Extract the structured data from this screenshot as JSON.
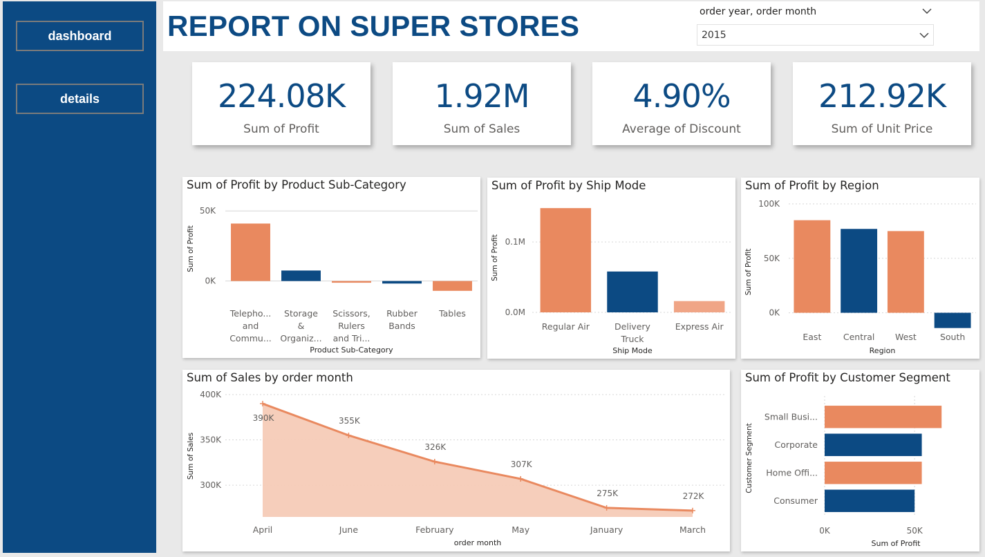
{
  "nav": {
    "dashboard": "dashboard",
    "details": "details"
  },
  "header": {
    "title": "REPORT ON SUPER STORES",
    "slicer_title": "order year, order month",
    "slicer_value": "2015"
  },
  "kpis": [
    {
      "value": "224.08K",
      "label": "Sum of Profit"
    },
    {
      "value": "1.92M",
      "label": "Sum of Sales"
    },
    {
      "value": "4.90%",
      "label": "Average of Discount"
    },
    {
      "value": "212.92K",
      "label": "Sum of Unit Price"
    }
  ],
  "colors": {
    "navy": "#0c4a83",
    "orange": "#e9895f",
    "light_orange": "#f0a586",
    "area_fill": "#f6cbb7",
    "grid": "#d6d6d6"
  },
  "chart_data": [
    {
      "type": "bar",
      "title": "Sum of Profit by Product Sub-Category",
      "xlabel": "Product Sub-Category",
      "ylabel": "Sum of Profit",
      "categories": [
        [
          "Telepho...",
          "and",
          "Commu..."
        ],
        [
          "Storage",
          "&",
          "Organiz..."
        ],
        [
          "Scissors,",
          "Rulers",
          "and Tri..."
        ],
        [
          "Rubber",
          "Bands"
        ],
        [
          "Tables"
        ]
      ],
      "values": [
        41000,
        7500,
        -1200,
        -1800,
        -7000
      ],
      "colors": [
        "#e9895f",
        "#0c4a83",
        "#e9895f",
        "#0c4a83",
        "#e9895f"
      ],
      "ylim": [
        -12000,
        58000
      ],
      "yticks": [
        0,
        50000
      ],
      "yticklabels": [
        "0K",
        "50K"
      ]
    },
    {
      "type": "bar",
      "title": "Sum of Profit by Ship Mode",
      "xlabel": "Ship Mode",
      "ylabel": "Sum of Profit",
      "categories": [
        [
          "Regular Air"
        ],
        [
          "Delivery",
          "Truck"
        ],
        [
          "Express Air"
        ]
      ],
      "values": [
        148000,
        58000,
        16000
      ],
      "colors": [
        "#e9895f",
        "#0c4a83",
        "#f0a586"
      ],
      "ylim": [
        0,
        155000
      ],
      "yticks": [
        0,
        100000
      ],
      "yticklabels": [
        "0.0M",
        "0.1M"
      ]
    },
    {
      "type": "bar",
      "title": "Sum of Profit by Region",
      "xlabel": "Region",
      "ylabel": "Sum of Profit",
      "categories": [
        [
          "East"
        ],
        [
          "Central"
        ],
        [
          "West"
        ],
        [
          "South"
        ]
      ],
      "values": [
        85000,
        77000,
        75000,
        -14000
      ],
      "colors": [
        "#e9895f",
        "#0c4a83",
        "#e9895f",
        "#0c4a83"
      ],
      "ylim": [
        -25000,
        100000
      ],
      "yticks": [
        0,
        50000,
        100000
      ],
      "yticklabels": [
        "0K",
        "50K",
        "100K"
      ]
    },
    {
      "type": "area",
      "title": "Sum of Sales by order month",
      "xlabel": "order month",
      "ylabel": "Sum of Sales",
      "categories": [
        "April",
        "June",
        "February",
        "May",
        "January",
        "March"
      ],
      "values": [
        390000,
        355000,
        326000,
        307000,
        275000,
        272000
      ],
      "data_labels": [
        "390K",
        "355K",
        "326K",
        "307K",
        "275K",
        "272K"
      ],
      "ylim": [
        265000,
        400000
      ],
      "yticks": [
        300000,
        350000,
        400000
      ],
      "yticklabels": [
        "300K",
        "350K",
        "400K"
      ]
    },
    {
      "type": "hbar",
      "title": "Sum of Profit by Customer Segment",
      "xlabel": "Sum of Profit",
      "ylabel": "Customer Segment",
      "categories": [
        "Small Busi...",
        "Corporate",
        "Home Offi...",
        "Consumer"
      ],
      "values": [
        65000,
        54000,
        54000,
        50000
      ],
      "colors": [
        "#e9895f",
        "#0c4a83",
        "#e9895f",
        "#0c4a83"
      ],
      "xlim": [
        0,
        68000
      ],
      "xticks": [
        0,
        50000
      ],
      "xticklabels": [
        "0K",
        "50K"
      ]
    }
  ]
}
